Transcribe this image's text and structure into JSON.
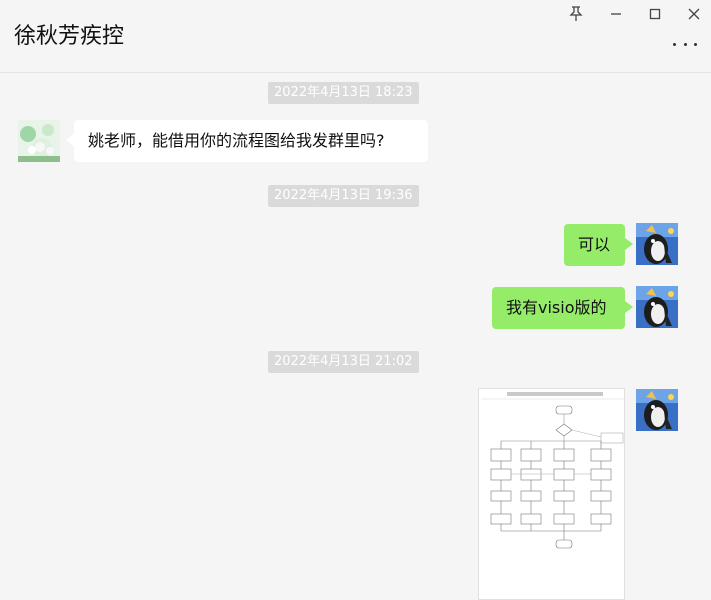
{
  "header": {
    "title": "徐秋芳疾控"
  },
  "window_controls": [
    "pin-icon",
    "minimize-icon",
    "maximize-icon",
    "close-icon"
  ],
  "messages": [
    {
      "type": "timestamp",
      "text": "2022年4月13日 18:23"
    },
    {
      "type": "text",
      "side": "left",
      "text": "姚老师，能借用你的流程图给我发群里吗?"
    },
    {
      "type": "timestamp",
      "text": "2022年4月13日 19:36"
    },
    {
      "type": "text",
      "side": "right",
      "text": "可以"
    },
    {
      "type": "text",
      "side": "right",
      "text": "我有visio版的"
    },
    {
      "type": "timestamp",
      "text": "2022年4月13日 21:02"
    },
    {
      "type": "image",
      "side": "right",
      "content": "flowchart-image"
    }
  ],
  "colors": {
    "self_bubble": "#95ec69",
    "other_bubble": "#ffffff",
    "background": "#f5f5f5",
    "timestamp_bg": "#dadada"
  }
}
